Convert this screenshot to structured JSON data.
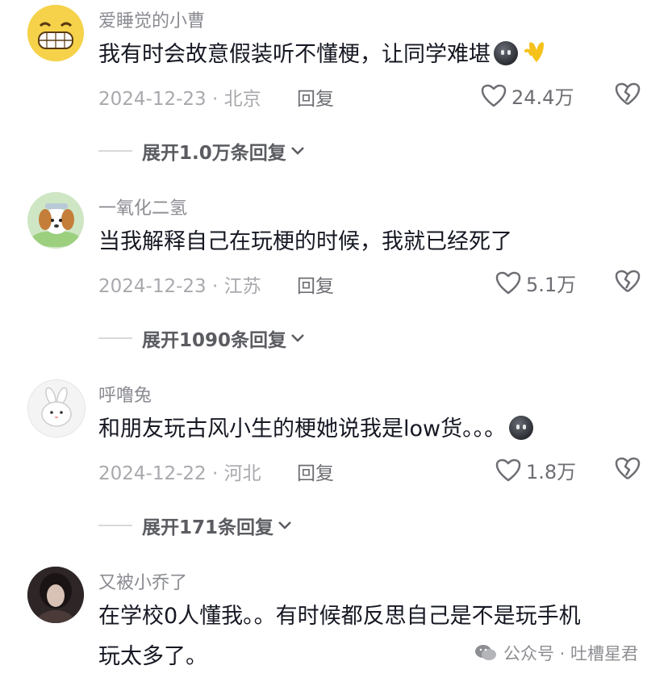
{
  "comments": [
    {
      "username": "爱睡觉的小曹",
      "text": "我有时会故意假装听不懂梗，让同学难堪",
      "emojis": [
        "dark-face-emoji",
        "yellow-heart-emoji"
      ],
      "date_location": "2024-12-23 · 北京",
      "reply_label": "回复",
      "likes": "24.4万",
      "expand_label": "展开1.0万条回复"
    },
    {
      "username": "一氧化二氢",
      "text": "当我解释自己在玩梗的时候，我就已经死了",
      "date_location": "2024-12-23 · 江苏",
      "reply_label": "回复",
      "likes": "5.1万",
      "expand_label": "展开1090条回复"
    },
    {
      "username": "呼噜兔",
      "text": "和朋友玩古风小生的梗她说我是low货。。。",
      "emojis": [
        "dark-face-emoji"
      ],
      "date_location": "2024-12-22 · 河北",
      "reply_label": "回复",
      "likes": "1.8万",
      "expand_label": "展开171条回复"
    },
    {
      "username": "又被小乔了",
      "text_line1": "在学校0人懂我。。有时候都反思自己是不是玩手机",
      "text_line2": "玩太多了。"
    }
  ],
  "watermark": "公众号 · 吐槽星君",
  "icons": {
    "like": "heart-outline-icon",
    "dislike": "broken-heart-icon",
    "expand": "chevron-down-icon",
    "watermark": "wechat-icon"
  },
  "colors": {
    "text": "#161823",
    "muted": "#a8a9ad",
    "username": "#8a8b91"
  }
}
